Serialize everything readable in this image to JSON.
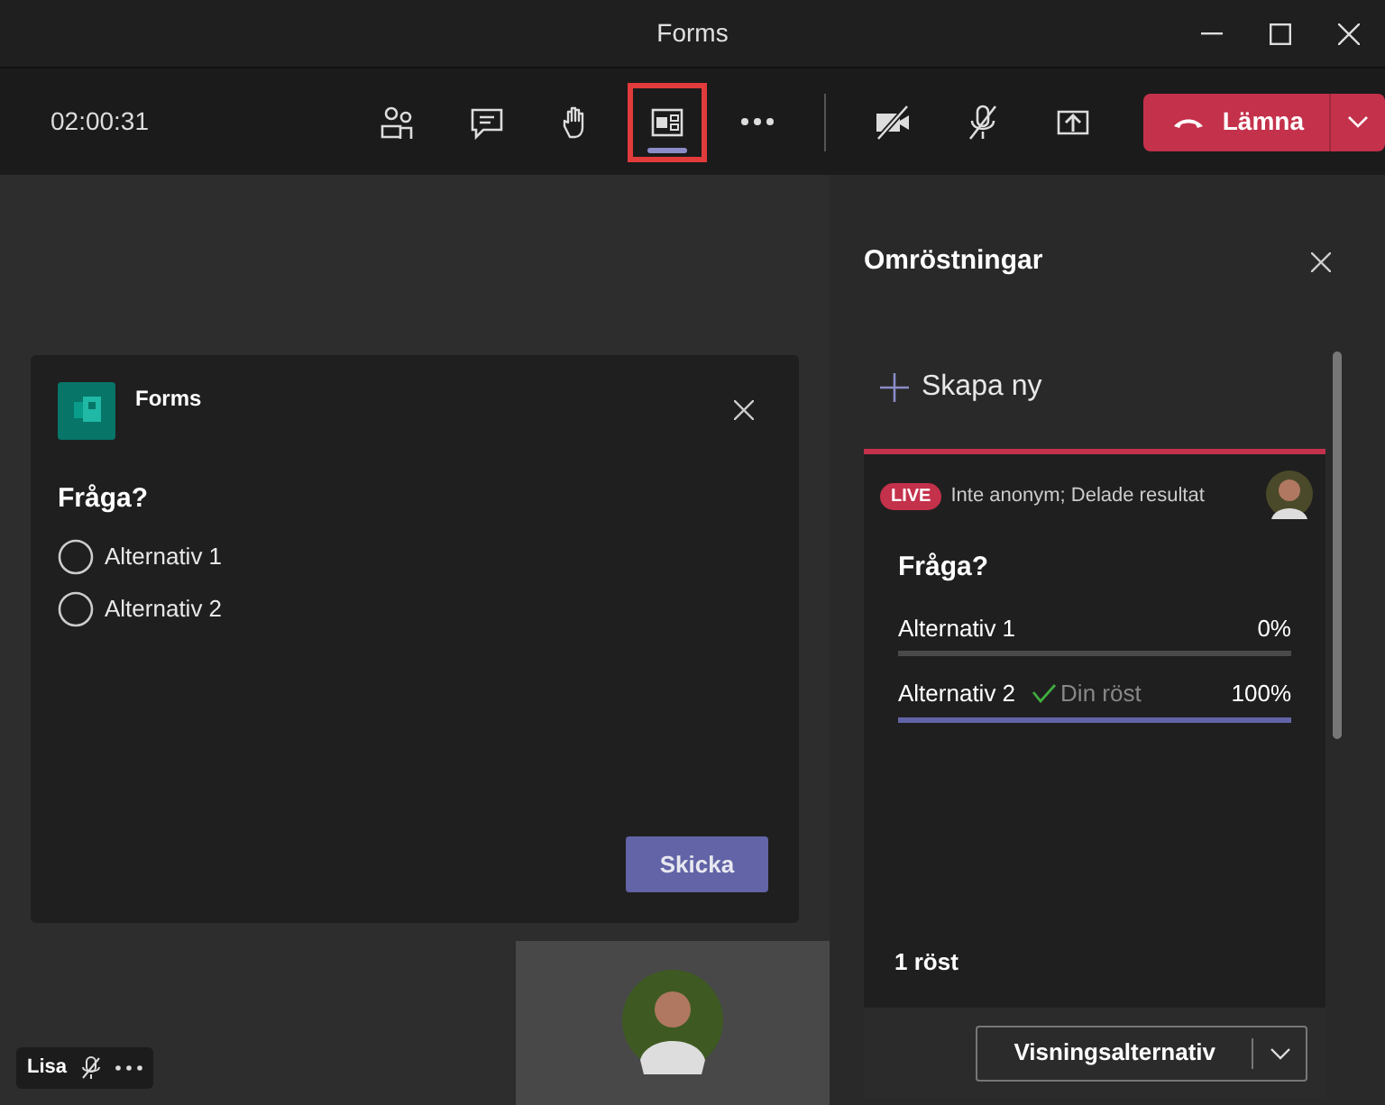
{
  "window": {
    "title": "Forms"
  },
  "toolbar": {
    "timer": "02:00:31",
    "buttons": [
      {
        "kind": "people",
        "selected": false,
        "highlighted": false
      },
      {
        "kind": "chat",
        "selected": false,
        "highlighted": false
      },
      {
        "kind": "hand",
        "selected": false,
        "highlighted": false
      },
      {
        "kind": "forms",
        "selected": true,
        "highlighted": true
      },
      {
        "kind": "more",
        "selected": false,
        "highlighted": false
      }
    ],
    "media": [
      {
        "kind": "camera"
      },
      {
        "kind": "mic"
      },
      {
        "kind": "share"
      }
    ],
    "leave": "Lämna"
  },
  "poll_dialog": {
    "app": "Forms",
    "question": "Fråga?",
    "options": [
      {
        "label": "Alternativ 1",
        "selected": false
      },
      {
        "label": "Alternativ 2",
        "selected": false
      }
    ],
    "submit": "Skicka"
  },
  "participant": {
    "name": "Lisa",
    "muted": true
  },
  "panel": {
    "title": "Omröstningar",
    "create": "Skapa ny",
    "poll": {
      "badge": "LIVE",
      "meta": "Inte anonym; Delade resultat",
      "question": "Fråga?",
      "results": [
        {
          "label": "Alternativ 1",
          "percent": "0%",
          "my_vote": false
        },
        {
          "label": "Alternativ 2",
          "note": "Din röst",
          "percent": "100%",
          "level": 1,
          "my_vote": true
        }
      ],
      "total": "1 röst"
    },
    "view_button": "Visningsalternativ"
  }
}
